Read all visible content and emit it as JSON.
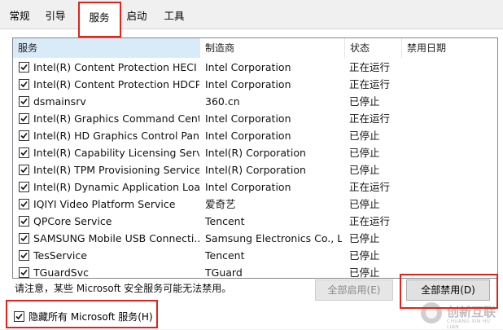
{
  "tabs": [
    "常规",
    "引导",
    "服务",
    "启动",
    "工具"
  ],
  "active_tab": "服务",
  "columns": {
    "service": "服务",
    "manufacturer": "制造商",
    "status": "状态",
    "disabled_date": "禁用日期"
  },
  "services": [
    {
      "name": "Intel(R) Content Protection HECI ...",
      "manufacturer": "Intel Corporation",
      "status": "正在运行",
      "date": "",
      "checked": true
    },
    {
      "name": "Intel(R) Content Protection HDCP...",
      "manufacturer": "Intel Corporation",
      "status": "正在运行",
      "date": "",
      "checked": true
    },
    {
      "name": "dsmainsrv",
      "manufacturer": "360.cn",
      "status": "已停止",
      "date": "",
      "checked": true
    },
    {
      "name": "Intel(R) Graphics Command Cent...",
      "manufacturer": "Intel Corporation",
      "status": "正在运行",
      "date": "",
      "checked": true
    },
    {
      "name": "Intel(R) HD Graphics Control Pan...",
      "manufacturer": "Intel Corporation",
      "status": "已停止",
      "date": "",
      "checked": true
    },
    {
      "name": "Intel(R) Capability Licensing Servi...",
      "manufacturer": "Intel(R) Corporation",
      "status": "已停止",
      "date": "",
      "checked": true
    },
    {
      "name": "Intel(R) TPM Provisioning Service",
      "manufacturer": "Intel(R) Corporation",
      "status": "已停止",
      "date": "",
      "checked": true
    },
    {
      "name": "Intel(R) Dynamic Application Loa...",
      "manufacturer": "Intel Corporation",
      "status": "正在运行",
      "date": "",
      "checked": true
    },
    {
      "name": "IQIYI Video Platform Service",
      "manufacturer": "爱奇艺",
      "status": "已停止",
      "date": "",
      "checked": true
    },
    {
      "name": "QPCore Service",
      "manufacturer": "Tencent",
      "status": "正在运行",
      "date": "",
      "checked": true
    },
    {
      "name": "SAMSUNG Mobile USB Connecti...",
      "manufacturer": "Samsung Electronics Co., L...",
      "status": "已停止",
      "date": "",
      "checked": true
    },
    {
      "name": "TesService",
      "manufacturer": "Tencent",
      "status": "已停止",
      "date": "",
      "checked": true
    },
    {
      "name": "TGuardSvc",
      "manufacturer": "TGuard",
      "status": "已停止",
      "date": "",
      "checked": true
    }
  ],
  "note": "请注意，某些 Microsoft 安全服务可能无法禁用。",
  "buttons": {
    "enable_all": "全部启用(E)",
    "disable_all": "全部禁用(D)"
  },
  "hide_ms": {
    "label": "隐藏所有 Microsoft 服务(H)",
    "checked": true
  },
  "watermark": {
    "zh": "创新互联",
    "en": "CHUANG XIN HU LIAN"
  },
  "colors": {
    "highlight": "#e0241c",
    "sorted_header": "#d9ebf9"
  }
}
